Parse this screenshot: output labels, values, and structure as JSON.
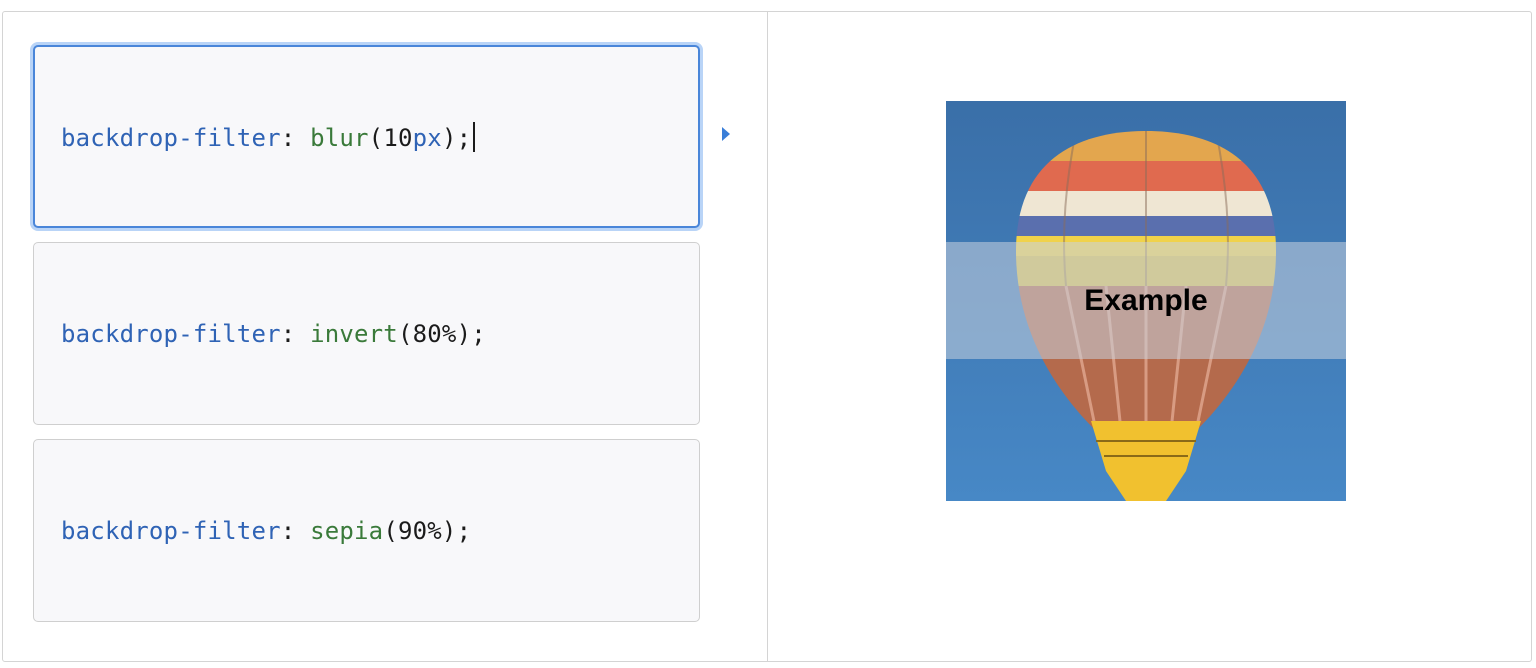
{
  "choices": [
    {
      "property": "backdrop-filter",
      "colon": ": ",
      "function": "blur",
      "open": "(",
      "value": "10",
      "unit": "px",
      "close": ");",
      "selected": true
    },
    {
      "property": "backdrop-filter",
      "colon": ": ",
      "function": "invert",
      "open": "(",
      "value": "80%",
      "unit": "",
      "close": ");",
      "selected": false
    },
    {
      "property": "backdrop-filter",
      "colon": ": ",
      "function": "sepia",
      "open": "(",
      "value": "90%",
      "unit": "",
      "close": ");",
      "selected": false
    }
  ],
  "output": {
    "label": "Example",
    "image": "hot-air-balloon"
  },
  "icons": {
    "run_indicator": "play-triangle-icon"
  },
  "colors": {
    "property": "#2f63b5",
    "function": "#3a7a3a",
    "selected_border": "#4a86d9",
    "sky": "#3f7fc1"
  }
}
